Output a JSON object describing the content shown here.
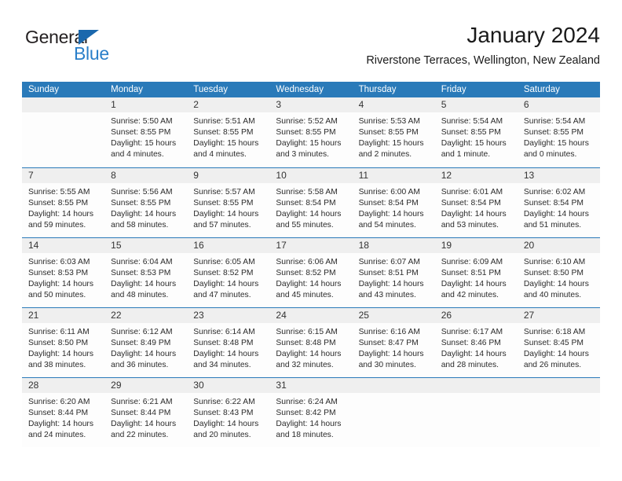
{
  "logo": {
    "word_top": "General",
    "word_bottom": "Blue",
    "triangle_color": "#1b68ad",
    "bottom_color": "#2a7fc9"
  },
  "header": {
    "month_title": "January 2024",
    "location": "Riverstone Terraces, Wellington, New Zealand",
    "header_bg": "#2a7ab9",
    "daynum_bg": "#efefef"
  },
  "weekday_headers": [
    "Sunday",
    "Monday",
    "Tuesday",
    "Wednesday",
    "Thursday",
    "Friday",
    "Saturday"
  ],
  "labels": {
    "sunrise_prefix": "Sunrise:",
    "sunset_prefix": "Sunset:",
    "daylight_prefix": "Daylight:"
  },
  "weeks": [
    [
      {
        "day": "",
        "sunrise": "",
        "sunset": "",
        "daylight_1": "",
        "daylight_2": ""
      },
      {
        "day": "1",
        "sunrise": "Sunrise: 5:50 AM",
        "sunset": "Sunset: 8:55 PM",
        "daylight_1": "Daylight: 15 hours",
        "daylight_2": "and 4 minutes."
      },
      {
        "day": "2",
        "sunrise": "Sunrise: 5:51 AM",
        "sunset": "Sunset: 8:55 PM",
        "daylight_1": "Daylight: 15 hours",
        "daylight_2": "and 4 minutes."
      },
      {
        "day": "3",
        "sunrise": "Sunrise: 5:52 AM",
        "sunset": "Sunset: 8:55 PM",
        "daylight_1": "Daylight: 15 hours",
        "daylight_2": "and 3 minutes."
      },
      {
        "day": "4",
        "sunrise": "Sunrise: 5:53 AM",
        "sunset": "Sunset: 8:55 PM",
        "daylight_1": "Daylight: 15 hours",
        "daylight_2": "and 2 minutes."
      },
      {
        "day": "5",
        "sunrise": "Sunrise: 5:54 AM",
        "sunset": "Sunset: 8:55 PM",
        "daylight_1": "Daylight: 15 hours",
        "daylight_2": "and 1 minute."
      },
      {
        "day": "6",
        "sunrise": "Sunrise: 5:54 AM",
        "sunset": "Sunset: 8:55 PM",
        "daylight_1": "Daylight: 15 hours",
        "daylight_2": "and 0 minutes."
      }
    ],
    [
      {
        "day": "7",
        "sunrise": "Sunrise: 5:55 AM",
        "sunset": "Sunset: 8:55 PM",
        "daylight_1": "Daylight: 14 hours",
        "daylight_2": "and 59 minutes."
      },
      {
        "day": "8",
        "sunrise": "Sunrise: 5:56 AM",
        "sunset": "Sunset: 8:55 PM",
        "daylight_1": "Daylight: 14 hours",
        "daylight_2": "and 58 minutes."
      },
      {
        "day": "9",
        "sunrise": "Sunrise: 5:57 AM",
        "sunset": "Sunset: 8:55 PM",
        "daylight_1": "Daylight: 14 hours",
        "daylight_2": "and 57 minutes."
      },
      {
        "day": "10",
        "sunrise": "Sunrise: 5:58 AM",
        "sunset": "Sunset: 8:54 PM",
        "daylight_1": "Daylight: 14 hours",
        "daylight_2": "and 55 minutes."
      },
      {
        "day": "11",
        "sunrise": "Sunrise: 6:00 AM",
        "sunset": "Sunset: 8:54 PM",
        "daylight_1": "Daylight: 14 hours",
        "daylight_2": "and 54 minutes."
      },
      {
        "day": "12",
        "sunrise": "Sunrise: 6:01 AM",
        "sunset": "Sunset: 8:54 PM",
        "daylight_1": "Daylight: 14 hours",
        "daylight_2": "and 53 minutes."
      },
      {
        "day": "13",
        "sunrise": "Sunrise: 6:02 AM",
        "sunset": "Sunset: 8:54 PM",
        "daylight_1": "Daylight: 14 hours",
        "daylight_2": "and 51 minutes."
      }
    ],
    [
      {
        "day": "14",
        "sunrise": "Sunrise: 6:03 AM",
        "sunset": "Sunset: 8:53 PM",
        "daylight_1": "Daylight: 14 hours",
        "daylight_2": "and 50 minutes."
      },
      {
        "day": "15",
        "sunrise": "Sunrise: 6:04 AM",
        "sunset": "Sunset: 8:53 PM",
        "daylight_1": "Daylight: 14 hours",
        "daylight_2": "and 48 minutes."
      },
      {
        "day": "16",
        "sunrise": "Sunrise: 6:05 AM",
        "sunset": "Sunset: 8:52 PM",
        "daylight_1": "Daylight: 14 hours",
        "daylight_2": "and 47 minutes."
      },
      {
        "day": "17",
        "sunrise": "Sunrise: 6:06 AM",
        "sunset": "Sunset: 8:52 PM",
        "daylight_1": "Daylight: 14 hours",
        "daylight_2": "and 45 minutes."
      },
      {
        "day": "18",
        "sunrise": "Sunrise: 6:07 AM",
        "sunset": "Sunset: 8:51 PM",
        "daylight_1": "Daylight: 14 hours",
        "daylight_2": "and 43 minutes."
      },
      {
        "day": "19",
        "sunrise": "Sunrise: 6:09 AM",
        "sunset": "Sunset: 8:51 PM",
        "daylight_1": "Daylight: 14 hours",
        "daylight_2": "and 42 minutes."
      },
      {
        "day": "20",
        "sunrise": "Sunrise: 6:10 AM",
        "sunset": "Sunset: 8:50 PM",
        "daylight_1": "Daylight: 14 hours",
        "daylight_2": "and 40 minutes."
      }
    ],
    [
      {
        "day": "21",
        "sunrise": "Sunrise: 6:11 AM",
        "sunset": "Sunset: 8:50 PM",
        "daylight_1": "Daylight: 14 hours",
        "daylight_2": "and 38 minutes."
      },
      {
        "day": "22",
        "sunrise": "Sunrise: 6:12 AM",
        "sunset": "Sunset: 8:49 PM",
        "daylight_1": "Daylight: 14 hours",
        "daylight_2": "and 36 minutes."
      },
      {
        "day": "23",
        "sunrise": "Sunrise: 6:14 AM",
        "sunset": "Sunset: 8:48 PM",
        "daylight_1": "Daylight: 14 hours",
        "daylight_2": "and 34 minutes."
      },
      {
        "day": "24",
        "sunrise": "Sunrise: 6:15 AM",
        "sunset": "Sunset: 8:48 PM",
        "daylight_1": "Daylight: 14 hours",
        "daylight_2": "and 32 minutes."
      },
      {
        "day": "25",
        "sunrise": "Sunrise: 6:16 AM",
        "sunset": "Sunset: 8:47 PM",
        "daylight_1": "Daylight: 14 hours",
        "daylight_2": "and 30 minutes."
      },
      {
        "day": "26",
        "sunrise": "Sunrise: 6:17 AM",
        "sunset": "Sunset: 8:46 PM",
        "daylight_1": "Daylight: 14 hours",
        "daylight_2": "and 28 minutes."
      },
      {
        "day": "27",
        "sunrise": "Sunrise: 6:18 AM",
        "sunset": "Sunset: 8:45 PM",
        "daylight_1": "Daylight: 14 hours",
        "daylight_2": "and 26 minutes."
      }
    ],
    [
      {
        "day": "28",
        "sunrise": "Sunrise: 6:20 AM",
        "sunset": "Sunset: 8:44 PM",
        "daylight_1": "Daylight: 14 hours",
        "daylight_2": "and 24 minutes."
      },
      {
        "day": "29",
        "sunrise": "Sunrise: 6:21 AM",
        "sunset": "Sunset: 8:44 PM",
        "daylight_1": "Daylight: 14 hours",
        "daylight_2": "and 22 minutes."
      },
      {
        "day": "30",
        "sunrise": "Sunrise: 6:22 AM",
        "sunset": "Sunset: 8:43 PM",
        "daylight_1": "Daylight: 14 hours",
        "daylight_2": "and 20 minutes."
      },
      {
        "day": "31",
        "sunrise": "Sunrise: 6:24 AM",
        "sunset": "Sunset: 8:42 PM",
        "daylight_1": "Daylight: 14 hours",
        "daylight_2": "and 18 minutes."
      },
      {
        "day": "",
        "sunrise": "",
        "sunset": "",
        "daylight_1": "",
        "daylight_2": ""
      },
      {
        "day": "",
        "sunrise": "",
        "sunset": "",
        "daylight_1": "",
        "daylight_2": ""
      },
      {
        "day": "",
        "sunrise": "",
        "sunset": "",
        "daylight_1": "",
        "daylight_2": ""
      }
    ]
  ]
}
